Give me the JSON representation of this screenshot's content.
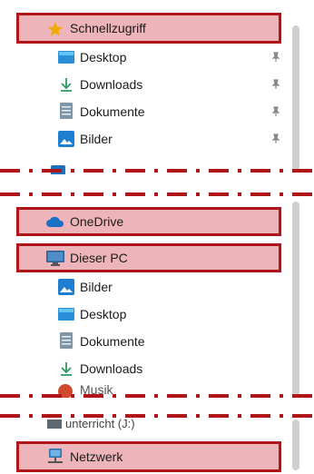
{
  "quick_access": {
    "title": "Schnellzugriff",
    "items": [
      {
        "label": "Desktop",
        "icon": "desktop-folder-icon",
        "pinned": true
      },
      {
        "label": "Downloads",
        "icon": "download-arrow-icon",
        "pinned": true
      },
      {
        "label": "Dokumente",
        "icon": "document-icon",
        "pinned": true
      },
      {
        "label": "Bilder",
        "icon": "pictures-icon",
        "pinned": true
      }
    ]
  },
  "onedrive": {
    "label": "OneDrive",
    "icon": "cloud-icon"
  },
  "this_pc": {
    "label": "Dieser PC",
    "icon": "monitor-icon",
    "items": [
      {
        "label": "Bilder",
        "icon": "pictures-icon"
      },
      {
        "label": "Desktop",
        "icon": "desktop-folder-icon"
      },
      {
        "label": "Dokumente",
        "icon": "document-icon"
      },
      {
        "label": "Downloads",
        "icon": "download-arrow-icon"
      },
      {
        "label": "Musik",
        "icon": "music-icon"
      }
    ],
    "drive_partial": "unterricht (J:)"
  },
  "network": {
    "label": "Netzwerk",
    "icon": "network-icon"
  },
  "colors": {
    "highlight_border": "#b0151a",
    "highlight_fill": "#d65a64",
    "accent_blue": "#1a73c9"
  }
}
